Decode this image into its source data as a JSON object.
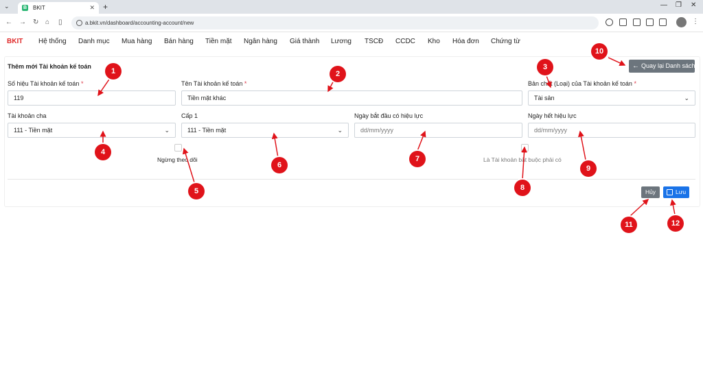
{
  "browser": {
    "tab_title": "BKIT",
    "favicon_letter": "B",
    "url": "a.bkit.vn/dashboard/accounting-account/new"
  },
  "nav": {
    "brand": "BKIT",
    "items": [
      "Hệ thống",
      "Danh mục",
      "Mua hàng",
      "Bán hàng",
      "Tiền mặt",
      "Ngân hàng",
      "Giá thành",
      "Lương",
      "TSCĐ",
      "CCDC",
      "Kho",
      "Hóa đơn",
      "Chứng từ"
    ]
  },
  "page": {
    "title": "Thêm mới Tài khoản kế toán",
    "back_label": "Quay lại Danh sách"
  },
  "form": {
    "account_code": {
      "label": "Số hiệu Tài khoản kế toán",
      "required": "*",
      "value": "119"
    },
    "account_name": {
      "label": "Tên Tài khoản kế toán",
      "required": "*",
      "value": "Tiền mặt khác"
    },
    "nature": {
      "label": "Bản chất (Loại) của Tài khoản kế toán",
      "required": "*",
      "value": "Tài sản"
    },
    "parent": {
      "label": "Tài khoản cha",
      "value": "111 - Tiền mặt"
    },
    "level": {
      "label": "Cấp 1",
      "value": "111 - Tiền mặt"
    },
    "start_date": {
      "label": "Ngày bắt đầu có hiệu lực",
      "placeholder": "dd/mm/yyyy"
    },
    "end_date": {
      "label": "Ngày hết hiệu lực",
      "placeholder": "dd/mm/yyyy"
    },
    "stop_tracking": {
      "label": "Ngừng theo dõi"
    },
    "mandatory": {
      "label": "Là Tài khoản bắt buộc phải có"
    }
  },
  "actions": {
    "cancel": "Hủy",
    "save": "Lưu"
  },
  "markers": [
    "1",
    "2",
    "3",
    "4",
    "5",
    "6",
    "7",
    "8",
    "9",
    "10",
    "11",
    "12"
  ],
  "colors": {
    "marker": "#e0131a",
    "brand": "#e02b2b",
    "save": "#1a73e8",
    "cancel": "#6c757d"
  }
}
